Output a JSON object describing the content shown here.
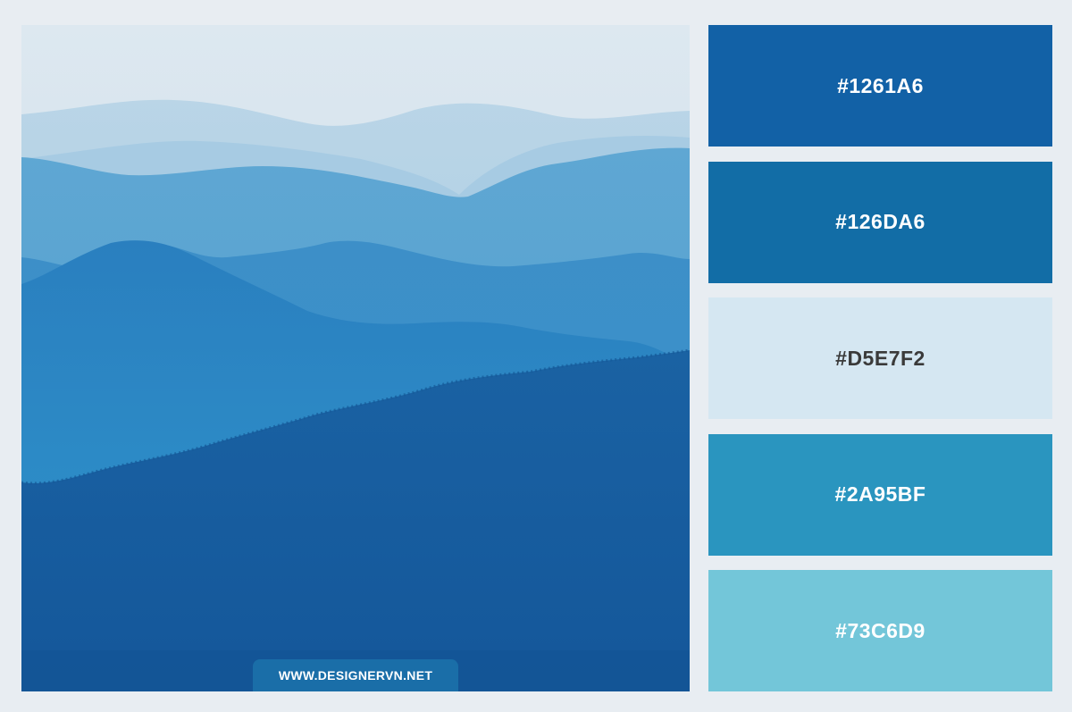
{
  "watermark": "WWW.DESIGNERVN.NET",
  "swatches": [
    {
      "hex": "#1261A6",
      "color": "#1261A6",
      "text_color": "#ffffff"
    },
    {
      "hex": "#126DA6",
      "color": "#126DA6",
      "text_color": "#ffffff"
    },
    {
      "hex": "#D5E7F2",
      "color": "#D5E7F2",
      "text_color": "#3a3a3a"
    },
    {
      "hex": "#2A95BF",
      "color": "#2A95BF",
      "text_color": "#ffffff"
    },
    {
      "hex": "#73C6D9",
      "color": "#73C6D9",
      "text_color": "#ffffff"
    }
  ]
}
